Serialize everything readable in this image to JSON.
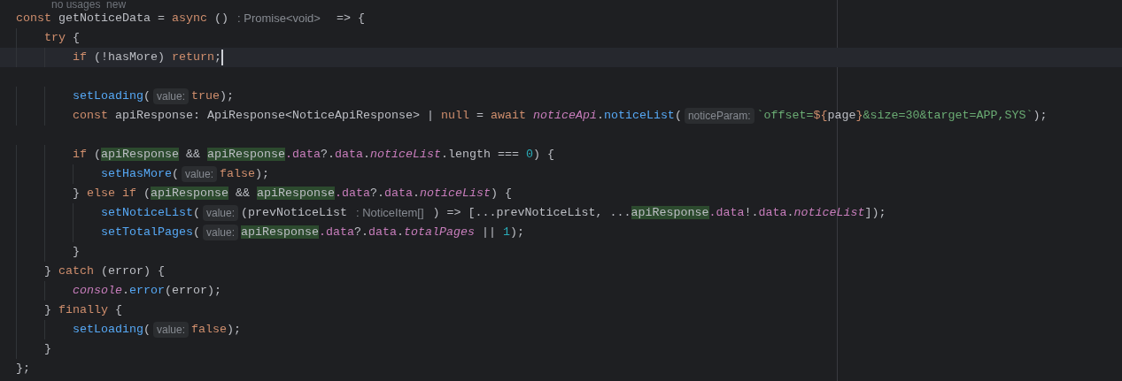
{
  "usage_hint": "no usages  new",
  "lines": [
    {
      "current": false,
      "segments": [
        {
          "kind": "code",
          "tokens": [
            {
              "kind": "keyword",
              "text": "const "
            },
            {
              "kind": "plain",
              "text": "getNoticeData = "
            },
            {
              "kind": "keyword",
              "text": "async "
            },
            {
              "kind": "plain",
              "text": "() "
            }
          ]
        },
        {
          "kind": "type",
          "text": ": Promise<void>"
        },
        {
          "kind": "code",
          "tokens": [
            {
              "kind": "plain",
              "text": "  => {"
            }
          ]
        }
      ]
    },
    {
      "current": false,
      "segments": [
        {
          "kind": "code",
          "tokens": [
            {
              "kind": "keyword",
              "text": "    try "
            },
            {
              "kind": "plain",
              "text": "{"
            }
          ]
        }
      ]
    },
    {
      "current": true,
      "segments": [
        {
          "kind": "code",
          "tokens": [
            {
              "kind": "keyword",
              "text": "        if "
            },
            {
              "kind": "plain",
              "text": "(!hasMore) "
            },
            {
              "kind": "keyword",
              "text": "return"
            },
            {
              "kind": "plain",
              "text": ";"
            }
          ]
        }
      ]
    },
    {
      "current": false
    },
    {
      "current": false,
      "segments": [
        {
          "kind": "code",
          "tokens": [
            {
              "kind": "function",
              "text": "        setLoading"
            },
            {
              "kind": "plain",
              "text": "("
            }
          ]
        },
        {
          "kind": "inlay",
          "text": "value:"
        },
        {
          "kind": "code",
          "tokens": [
            {
              "kind": "keyword",
              "text": "true"
            },
            {
              "kind": "plain",
              "text": ");"
            }
          ]
        }
      ]
    },
    {
      "current": false,
      "segments": [
        {
          "kind": "code",
          "tokens": [
            {
              "kind": "keyword",
              "text": "        const "
            },
            {
              "kind": "plain",
              "text": "apiResponse: ApiResponse<NoticeApiResponse> | "
            },
            {
              "kind": "keyword",
              "text": "null "
            },
            {
              "kind": "plain",
              "text": "= "
            },
            {
              "kind": "keyword",
              "text": "await "
            },
            {
              "kind": "italic",
              "text": "noticeApi"
            },
            {
              "kind": "plain",
              "text": "."
            },
            {
              "kind": "function",
              "text": "noticeList"
            },
            {
              "kind": "plain",
              "text": "("
            }
          ]
        },
        {
          "kind": "inlay",
          "text": "noticeParam:"
        },
        {
          "kind": "code",
          "tokens": [
            {
              "kind": "string",
              "text": "`offset="
            },
            {
              "kind": "keyword",
              "text": "${"
            },
            {
              "kind": "plain",
              "text": "page"
            },
            {
              "kind": "keyword",
              "text": "}"
            },
            {
              "kind": "string",
              "text": "&size=30&target=APP,SYS`"
            },
            {
              "kind": "plain",
              "text": ");"
            }
          ]
        }
      ]
    },
    {
      "current": false
    },
    {
      "current": false,
      "segments": [
        {
          "kind": "code",
          "tokens": [
            {
              "kind": "keyword",
              "text": "        if "
            },
            {
              "kind": "plain",
              "text": "("
            },
            {
              "kind": "ref",
              "text": "apiResponse"
            },
            {
              "kind": "plain",
              "text": " && "
            },
            {
              "kind": "ref",
              "text": "apiResponse"
            },
            {
              "kind": "property",
              "text": ".data"
            },
            {
              "kind": "plain",
              "text": "?."
            },
            {
              "kind": "property",
              "text": "data"
            },
            {
              "kind": "plain",
              "text": "."
            },
            {
              "kind": "italic",
              "text": "noticeList"
            },
            {
              "kind": "plain",
              "text": ".length === "
            },
            {
              "kind": "number",
              "text": "0"
            },
            {
              "kind": "plain",
              "text": ") {"
            }
          ]
        }
      ]
    },
    {
      "current": false,
      "segments": [
        {
          "kind": "code",
          "tokens": [
            {
              "kind": "function",
              "text": "            setHasMore"
            },
            {
              "kind": "plain",
              "text": "("
            }
          ]
        },
        {
          "kind": "inlay",
          "text": "value:"
        },
        {
          "kind": "code",
          "tokens": [
            {
              "kind": "keyword",
              "text": "false"
            },
            {
              "kind": "plain",
              "text": ");"
            }
          ]
        }
      ]
    },
    {
      "current": false,
      "segments": [
        {
          "kind": "code",
          "tokens": [
            {
              "kind": "plain",
              "text": "        } "
            },
            {
              "kind": "keyword",
              "text": "else if "
            },
            {
              "kind": "plain",
              "text": "("
            },
            {
              "kind": "ref",
              "text": "apiResponse"
            },
            {
              "kind": "plain",
              "text": " && "
            },
            {
              "kind": "ref",
              "text": "apiResponse"
            },
            {
              "kind": "property",
              "text": ".data"
            },
            {
              "kind": "plain",
              "text": "?."
            },
            {
              "kind": "property",
              "text": "data"
            },
            {
              "kind": "plain",
              "text": "."
            },
            {
              "kind": "italic",
              "text": "noticeList"
            },
            {
              "kind": "plain",
              "text": ") {"
            }
          ]
        }
      ]
    },
    {
      "current": false,
      "segments": [
        {
          "kind": "code",
          "tokens": [
            {
              "kind": "function",
              "text": "            setNoticeList"
            },
            {
              "kind": "plain",
              "text": "("
            }
          ]
        },
        {
          "kind": "inlay",
          "text": "value:"
        },
        {
          "kind": "code",
          "tokens": [
            {
              "kind": "plain",
              "text": "(prevNoticeList "
            }
          ]
        },
        {
          "kind": "type",
          "text": ": NoticeItem[]"
        },
        {
          "kind": "code",
          "tokens": [
            {
              "kind": "plain",
              "text": " ) => [...prevNoticeList, ..."
            },
            {
              "kind": "ref",
              "text": "apiResponse"
            },
            {
              "kind": "property",
              "text": ".data"
            },
            {
              "kind": "plain",
              "text": "!."
            },
            {
              "kind": "property",
              "text": "data"
            },
            {
              "kind": "plain",
              "text": "."
            },
            {
              "kind": "italic",
              "text": "noticeList"
            },
            {
              "kind": "plain",
              "text": "]);"
            }
          ]
        }
      ]
    },
    {
      "current": false,
      "segments": [
        {
          "kind": "code",
          "tokens": [
            {
              "kind": "function",
              "text": "            setTotalPages"
            },
            {
              "kind": "plain",
              "text": "("
            }
          ]
        },
        {
          "kind": "inlay",
          "text": "value:"
        },
        {
          "kind": "code",
          "tokens": [
            {
              "kind": "ref",
              "text": "apiResponse"
            },
            {
              "kind": "property",
              "text": ".data"
            },
            {
              "kind": "plain",
              "text": "?."
            },
            {
              "kind": "property",
              "text": "data"
            },
            {
              "kind": "plain",
              "text": "."
            },
            {
              "kind": "italic",
              "text": "totalPages"
            },
            {
              "kind": "plain",
              "text": " || "
            },
            {
              "kind": "number",
              "text": "1"
            },
            {
              "kind": "plain",
              "text": ");"
            }
          ]
        }
      ]
    },
    {
      "current": false,
      "segments": [
        {
          "kind": "code",
          "tokens": [
            {
              "kind": "plain",
              "text": "        }"
            }
          ]
        }
      ]
    },
    {
      "current": false,
      "segments": [
        {
          "kind": "code",
          "tokens": [
            {
              "kind": "plain",
              "text": "    } "
            },
            {
              "kind": "keyword",
              "text": "catch "
            },
            {
              "kind": "plain",
              "text": "(error) {"
            }
          ]
        }
      ]
    },
    {
      "current": false,
      "segments": [
        {
          "kind": "code",
          "tokens": [
            {
              "kind": "italic",
              "text": "        console"
            },
            {
              "kind": "plain",
              "text": "."
            },
            {
              "kind": "function",
              "text": "error"
            },
            {
              "kind": "plain",
              "text": "(error);"
            }
          ]
        }
      ]
    },
    {
      "current": false,
      "segments": [
        {
          "kind": "code",
          "tokens": [
            {
              "kind": "plain",
              "text": "    } "
            },
            {
              "kind": "keyword",
              "text": "finally "
            },
            {
              "kind": "plain",
              "text": "{"
            }
          ]
        }
      ]
    },
    {
      "current": false,
      "segments": [
        {
          "kind": "code",
          "tokens": [
            {
              "kind": "function",
              "text": "        setLoading"
            },
            {
              "kind": "plain",
              "text": "("
            }
          ]
        },
        {
          "kind": "inlay",
          "text": "value:"
        },
        {
          "kind": "code",
          "tokens": [
            {
              "kind": "keyword",
              "text": "false"
            },
            {
              "kind": "plain",
              "text": ");"
            }
          ]
        }
      ]
    },
    {
      "current": false,
      "segments": [
        {
          "kind": "code",
          "tokens": [
            {
              "kind": "plain",
              "text": "    }"
            }
          ]
        }
      ]
    },
    {
      "current": false,
      "segments": [
        {
          "kind": "code",
          "tokens": [
            {
              "kind": "plain",
              "text": "};"
            }
          ]
        }
      ]
    }
  ]
}
